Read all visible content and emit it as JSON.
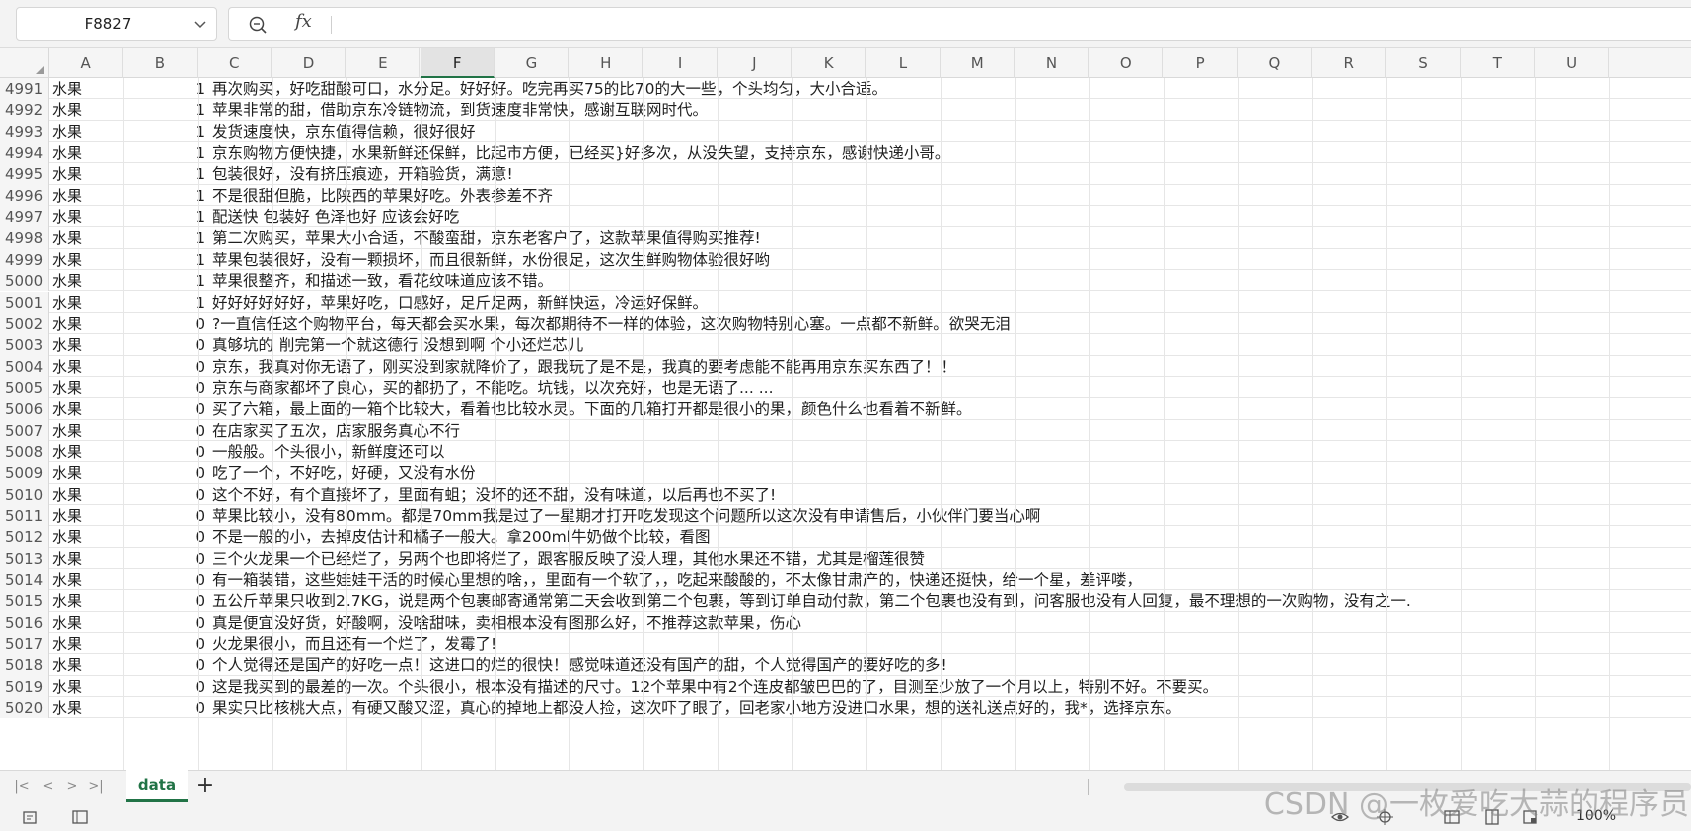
{
  "namebox": {
    "value": "F8827"
  },
  "formula": {
    "fx_label": "fx"
  },
  "columns": [
    "A",
    "B",
    "C",
    "D",
    "E",
    "F",
    "G",
    "H",
    "I",
    "J",
    "K",
    "L",
    "M",
    "N",
    "O",
    "P",
    "Q",
    "R",
    "S",
    "T",
    "U"
  ],
  "active_column": "F",
  "rows": [
    {
      "n": "4991",
      "a": "水果",
      "b": "1",
      "c": "再次购买，好吃甜酸可口，水分足。好好好。吃完再买75的比70的大一些，个头均匀，大小合适。"
    },
    {
      "n": "4992",
      "a": "水果",
      "b": "1",
      "c": "苹果非常的甜，借助京东冷链物流，到货速度非常快，感谢互联网时代。"
    },
    {
      "n": "4993",
      "a": "水果",
      "b": "1",
      "c": "发货速度快，京东值得信赖，很好很好"
    },
    {
      "n": "4994",
      "a": "水果",
      "b": "1",
      "c": "京东购物方便快捷，水果新鲜还保鲜，比起市方便，已经买}好多次，从没失望，支持京东，感谢快递小哥。"
    },
    {
      "n": "4995",
      "a": "水果",
      "b": "1",
      "c": "包装很好，没有挤压痕迹，开箱验货，满意!"
    },
    {
      "n": "4996",
      "a": "水果",
      "b": "1",
      "c": "不是很甜但脆，比陕西的苹果好吃。外表参差不齐"
    },
    {
      "n": "4997",
      "a": "水果",
      "b": "1",
      "c": "配送快 包装好 色泽也好 应该会好吃"
    },
    {
      "n": "4998",
      "a": "水果",
      "b": "1",
      "c": "第二次购买，苹果大小合适，不酸蛮甜，京东老客户了，这款苹果值得购买推荐!"
    },
    {
      "n": "4999",
      "a": "水果",
      "b": "1",
      "c": "苹果包装很好，没有一颗损坏，而且很新鲜，水份很足，这次生鲜购物体验很好哟"
    },
    {
      "n": "5000",
      "a": "水果",
      "b": "1",
      "c": "苹果很整齐，和描述一致，看花纹味道应该不错。"
    },
    {
      "n": "5001",
      "a": "水果",
      "b": "1",
      "c": "好好好好好好，苹果好吃，口感好，足斤足两，新鲜快运，冷运好保鲜。"
    },
    {
      "n": "5002",
      "a": "水果",
      "b": "0",
      "c": "?一直信任这个购物平台，每天都会买水果，每次都期待不一样的体验，这次购物特别心塞。一点都不新鲜。欲哭无泪"
    },
    {
      "n": "5003",
      "a": "水果",
      "b": "0",
      "c": "真够坑的 削完第一个就这德行 没想到啊 个小还烂芯儿"
    },
    {
      "n": "5004",
      "a": "水果",
      "b": "0",
      "c": "京东，我真对你无语了，刚买没到家就降价了，跟我玩了是不是，我真的要考虑能不能再用京东买东西了！！"
    },
    {
      "n": "5005",
      "a": "水果",
      "b": "0",
      "c": "京东与商家都坏了良心，买的都扔了，不能吃。坑钱，以次充好，也是无语了... ..."
    },
    {
      "n": "5006",
      "a": "水果",
      "b": "0",
      "c": "买了六箱，最上面的一箱个比较大，看着也比较水灵。下面的几箱打开都是很小的果，颜色什么也看着不新鲜。"
    },
    {
      "n": "5007",
      "a": "水果",
      "b": "0",
      "c": "在店家买了五次，店家服务真心不行"
    },
    {
      "n": "5008",
      "a": "水果",
      "b": "0",
      "c": "一般般。个头很小，新鲜度还可以"
    },
    {
      "n": "5009",
      "a": "水果",
      "b": "0",
      "c": "吃了一个，不好吃，好硬，又没有水份"
    },
    {
      "n": "5010",
      "a": "水果",
      "b": "0",
      "c": "这个不好，有个直接坏了，里面有蛆；没坏的还不甜，没有味道，以后再也不买了!"
    },
    {
      "n": "5011",
      "a": "水果",
      "b": "0",
      "c": "苹果比较小，没有80mm。都是70mm我是过了一星期才打开吃发现这个问题所以这次没有申请售后，小伙伴门要当心啊"
    },
    {
      "n": "5012",
      "a": "水果",
      "b": "0",
      "c": "不是一般的小，去掉皮估计和橘子一般大。拿200ml牛奶做个比较，看图"
    },
    {
      "n": "5013",
      "a": "水果",
      "b": "0",
      "c": "三个火龙果一个已经烂了，另两个也即将烂了，跟客服反映了没人理，其他水果还不错，尤其是榴莲很赞"
    },
    {
      "n": "5014",
      "a": "水果",
      "b": "0",
      "c": "有一箱装错，这些娃娃干活的时候心里想的啥，，里面有一个软了，，吃起来酸酸的，不太像甘肃产的，快递还挺快，给一个星，差评喽，"
    },
    {
      "n": "5015",
      "a": "水果",
      "b": "0",
      "c": "五公斤苹果只收到2.7KG，说是两个包裹邮寄通常第二天会收到第二个包裹，等到订单自动付款，第二个包裹也没有到，问客服也没有人回复，最不理想的一次购物，没有之一."
    },
    {
      "n": "5016",
      "a": "水果",
      "b": "0",
      "c": "真是便宜没好货，好酸啊，没啥甜味，卖相根本没有图那么好，不推荐这款苹果，伤心"
    },
    {
      "n": "5017",
      "a": "水果",
      "b": "0",
      "c": "火龙果很小，而且还有一个烂了，发霉了!"
    },
    {
      "n": "5018",
      "a": "水果",
      "b": "0",
      "c": "个人觉得还是国产的好吃一点！这进口的烂的很快！感觉味道还没有国产的甜，个人觉得国产的要好吃的多!"
    },
    {
      "n": "5019",
      "a": "水果",
      "b": "0",
      "c": "这是我买到的最差的一次。个头很小，根本没有描述的尺寸。12个苹果中有2个连皮都皱巴巴的了，目测至少放了一个月以上，特别不好。不要买。"
    },
    {
      "n": "5020",
      "a": "水果",
      "b": "0",
      "c": "果实只比核桃大点，有硬又酸又涩，真心的掉地上都没人捡，这次吓了眼了，回老家小地方没进口水果，想的送礼送点好的，我*，选择京东。"
    }
  ],
  "sheet_tab": {
    "label": "data"
  },
  "status": {
    "zoom": "100%"
  },
  "watermark": "CSDN @一枚爱吃大蒜的程序员"
}
